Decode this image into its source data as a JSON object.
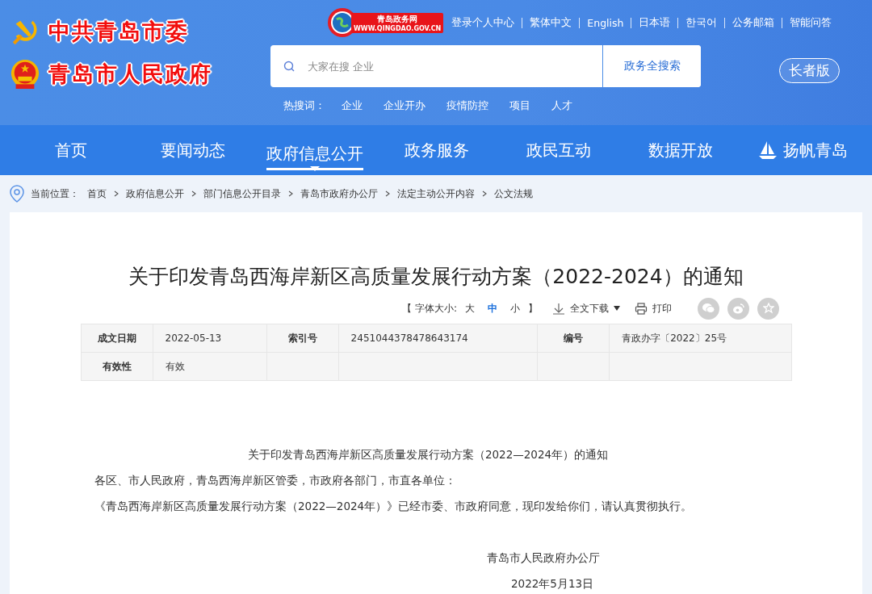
{
  "header": {
    "titles": [
      {
        "kind": "party",
        "text": "中共青岛市委"
      },
      {
        "kind": "government",
        "text": "青岛市人民政府"
      }
    ],
    "logo": {
      "title": "青岛政务网",
      "url": "WWW.QINGDAO.GOV.CN"
    },
    "top_links": [
      "登录个人中心",
      "繁体中文",
      "English",
      "日本语",
      "한국어",
      "公务邮箱",
      "智能问答"
    ],
    "search": {
      "placeholder": "大家在搜 企业",
      "button": "政务全搜索"
    },
    "hot_label": "热搜词：",
    "hot_words": [
      "企业",
      "企业开办",
      "疫情防控",
      "项目",
      "人才"
    ],
    "elder_button": "长者版"
  },
  "nav": [
    {
      "label": "首页",
      "selected": false
    },
    {
      "label": "要闻动态",
      "selected": false
    },
    {
      "label": "政府信息公开",
      "selected": true
    },
    {
      "label": "政务服务",
      "selected": false
    },
    {
      "label": "政民互动",
      "selected": false
    },
    {
      "label": "数据开放",
      "selected": false
    },
    {
      "label": "扬帆青岛",
      "selected": false,
      "kind": "ship"
    }
  ],
  "breadcrumb": {
    "label": "当前位置：",
    "items": [
      "首页",
      "政府信息公开",
      "部门信息公开目录",
      "青岛市政府办公厅",
      "法定主动公开内容",
      "公文法规"
    ]
  },
  "article": {
    "title": "关于印发青岛西海岸新区高质量发展行动方案（2022-2024）的通知",
    "tools": {
      "font_label": "【 字体大小:",
      "font_sizes": [
        {
          "label": "大",
          "selected": false
        },
        {
          "label": "中",
          "selected": true
        },
        {
          "label": "小",
          "selected": false
        }
      ],
      "font_end": "】",
      "download": "全文下载",
      "print": "打印"
    },
    "meta_rows": [
      {
        "fields": [
          {
            "label": "成文日期",
            "value": "2022-05-13"
          },
          {
            "label": "索引号",
            "value": "2451044378478643174"
          },
          {
            "label": "编号",
            "value": "青政办字〔2022〕25号"
          }
        ]
      },
      {
        "fields": [
          {
            "label": "有效性",
            "value": "有效"
          }
        ]
      }
    ],
    "body": [
      {
        "kind": "heading",
        "text": "关于印发青岛西海岸新区高质量发展行动方案（2022—2024年）的通知"
      },
      {
        "kind": "paragraph",
        "text": "各区、市人民政府，青岛西海岸新区管委，市政府各部门，市直各单位："
      },
      {
        "kind": "paragraph",
        "text": "《青岛西海岸新区高质量发展行动方案（2022—2024年）》已经市委、市政府同意，现印发给你们，请认真贯彻执行。"
      },
      {
        "kind": "signature",
        "text": "青岛市人民政府办公厅"
      },
      {
        "kind": "date",
        "text": "2022年5月13日"
      }
    ]
  }
}
